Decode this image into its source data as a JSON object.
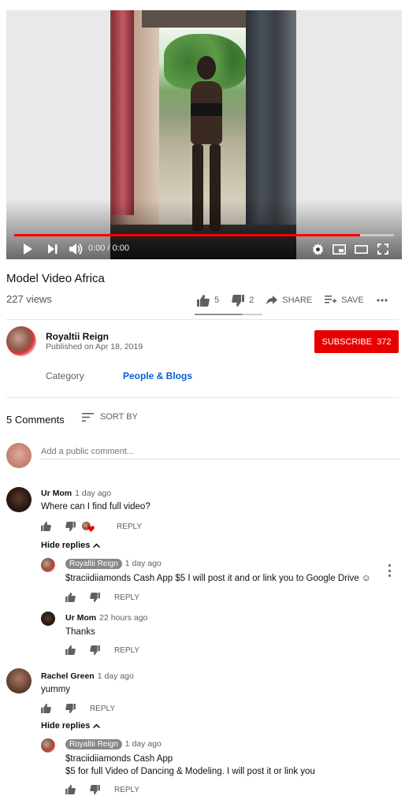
{
  "player": {
    "time_display": "0:00 / 0:00",
    "progress": 0.91
  },
  "video": {
    "title": "Model Video Africa",
    "views": "227 views",
    "likes": "5",
    "dislikes": "2",
    "share_label": "SHARE",
    "save_label": "SAVE",
    "like_ratio": 0.71
  },
  "channel": {
    "name": "Royaltii Reign",
    "published": "Published on Apr 18, 2019",
    "subscribe_label": "SUBSCRIBE",
    "subscriber_count": "372"
  },
  "category": {
    "label": "Category",
    "value": "People & Blogs"
  },
  "comments": {
    "count_label": "5 Comments",
    "sort_label": "SORT BY",
    "add_placeholder": "Add a public comment...",
    "reply_label": "REPLY",
    "hide_replies_label": "Hide replies",
    "threads": [
      {
        "author": "Ur Mom",
        "time": "1 day ago",
        "text": "Where can I find full video?",
        "replies": [
          {
            "author": "Royaltii Reign",
            "time": "1 day ago",
            "lines": [
              "$traciidiiamonds    Cash App $5 I will post it and or link you to Google Drive ☺"
            ]
          },
          {
            "author": "Ur Mom",
            "time": "22 hours ago",
            "lines": [
              "Thanks"
            ]
          }
        ]
      },
      {
        "author": "Rachel Green",
        "time": "1 day ago",
        "text": "yummy",
        "replies": [
          {
            "author": "Royaltii Reign",
            "time": "1 day ago",
            "lines": [
              "$traciidiiamonds  Cash App",
              "$5 for full Video of Dancing & Modeling. I will post it or link you"
            ]
          }
        ]
      }
    ]
  },
  "colors": {
    "accent_red": "#e60000",
    "link_blue": "#065fd4"
  },
  "icons": [
    "play-icon",
    "next-icon",
    "volume-icon",
    "settings-icon",
    "miniplayer-icon",
    "theater-icon",
    "fullscreen-icon",
    "thumb-up-icon",
    "thumb-down-icon",
    "share-icon",
    "playlist-add-icon",
    "more-icon",
    "sort-icon",
    "heart-icon",
    "chevron-up-icon"
  ]
}
